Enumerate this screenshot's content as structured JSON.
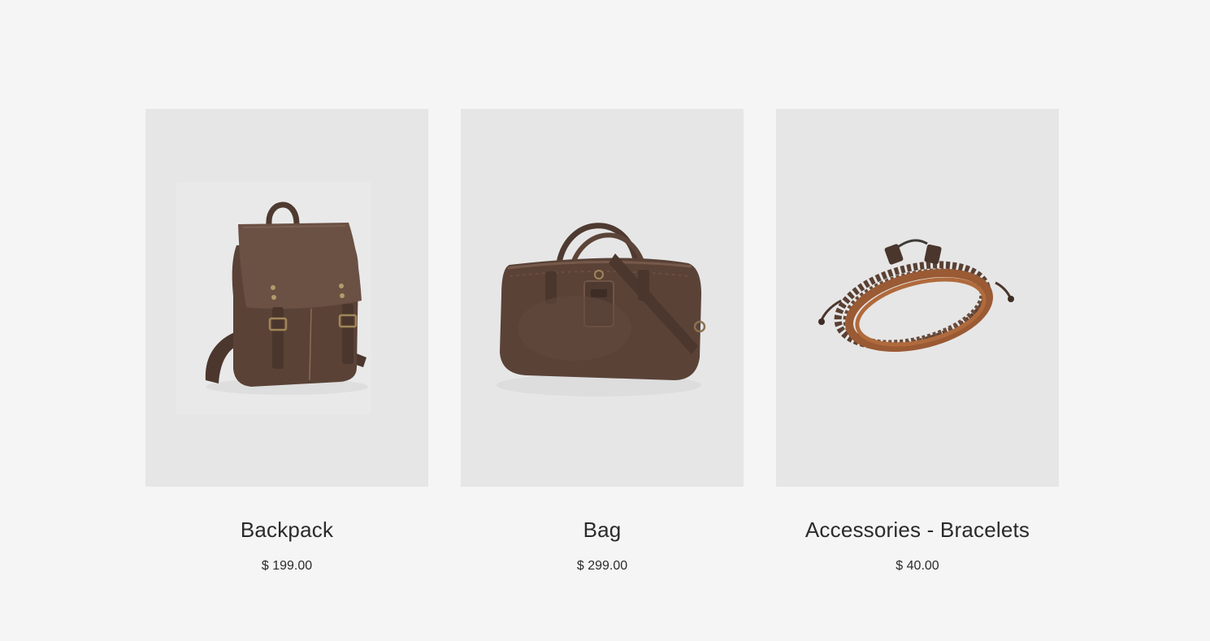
{
  "products": [
    {
      "name": "Backpack",
      "price": "$ 199.00",
      "image_icon": "backpack-image"
    },
    {
      "name": "Bag",
      "price": "$ 299.00",
      "image_icon": "duffel-bag-image"
    },
    {
      "name": "Accessories - Bracelets",
      "price": "$ 40.00",
      "image_icon": "leather-bracelet-image"
    }
  ],
  "colors": {
    "page_background": "#f5f5f5",
    "image_background": "#e6e6e6",
    "leather_dark": "#4e3a30",
    "leather_light": "#6b5044",
    "bracelet_tan": "#9a5a34",
    "text": "#2b2b2b"
  }
}
